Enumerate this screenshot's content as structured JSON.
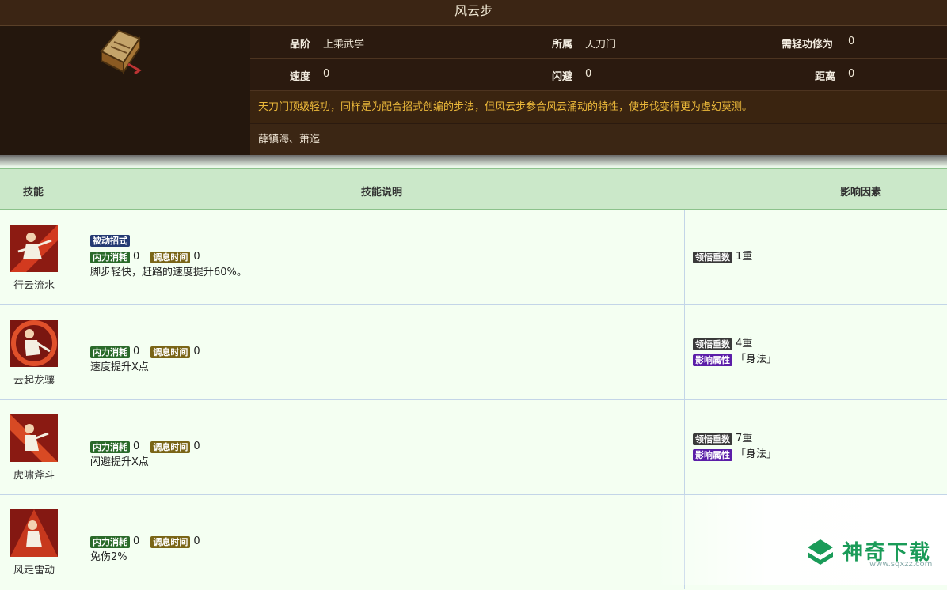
{
  "title": "风云步",
  "info": {
    "grade_label": "品阶",
    "grade_value": "上乘武学",
    "sect_label": "所属",
    "sect_value": "天刀门",
    "req_label": "需轻功修为",
    "req_value": "0",
    "speed_label": "速度",
    "speed_value": "0",
    "dodge_label": "闪避",
    "dodge_value": "0",
    "distance_label": "距离",
    "distance_value": "0",
    "description": "天刀门顶级轻功，同样是为配合招式创编的步法，但风云步参合风云涌动的特性，使步伐变得更为虚幻莫测。",
    "authors": "薛镇海、萧迄"
  },
  "table": {
    "col_skill": "技能",
    "col_desc": "技能说明",
    "col_factor": "影响因素"
  },
  "tags": {
    "passive": "被动招式",
    "mp": "内力消耗",
    "cooldown": "调息时间",
    "comprehend": "领悟重数",
    "attribute": "影响属性"
  },
  "skills": [
    {
      "name": "行云流水",
      "mp": "0",
      "cd": "0",
      "effect": "脚步轻快，赶路的速度提升60%。",
      "comprehend": "1重",
      "attribute": ""
    },
    {
      "name": "云起龙骧",
      "mp": "0",
      "cd": "0",
      "effect": "速度提升X点",
      "comprehend": "4重",
      "attribute": "「身法」"
    },
    {
      "name": "虎啸斧斗",
      "mp": "0",
      "cd": "0",
      "effect": "闪避提升X点",
      "comprehend": "7重",
      "attribute": "「身法」"
    },
    {
      "name": "风走雷动",
      "mp": "0",
      "cd": "0",
      "effect": "免伤2%",
      "comprehend": "",
      "attribute": ""
    }
  ],
  "watermark": {
    "brand": "神奇下载",
    "url": "www.sqxzz.com"
  },
  "colors": {
    "header_bg": "#3b2514",
    "desc_text": "#ecb93a",
    "table_head": "#cbe8c9",
    "row_bg": "#f4fff2"
  }
}
